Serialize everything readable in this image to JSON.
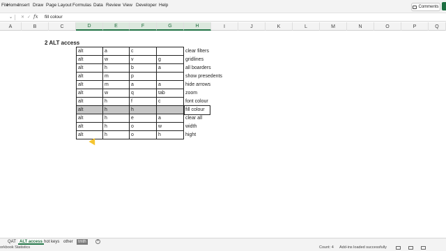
{
  "menu": {
    "items": [
      "File",
      "Home",
      "Insert",
      "Draw",
      "Page Layout",
      "Formulas",
      "Data",
      "Review",
      "View",
      "Developer",
      "Help"
    ],
    "comments_label": "Comments"
  },
  "formula_bar": {
    "fx": "fx",
    "content": "fill colour"
  },
  "columns": [
    "A",
    "B",
    "C",
    "D",
    "E",
    "F",
    "G",
    "H",
    "I",
    "J",
    "K",
    "L",
    "M",
    "N",
    "O",
    "P",
    "Q"
  ],
  "sheet": {
    "title": "2  ALT access",
    "rows": [
      {
        "c1": "alt",
        "c2": "a",
        "c3": "c",
        "c4": "",
        "desc": "clear filters"
      },
      {
        "c1": "alt",
        "c2": "w",
        "c3": "v",
        "c4": "g",
        "desc": "gridlines"
      },
      {
        "c1": "alt",
        "c2": "h",
        "c3": "b",
        "c4": "a",
        "desc": "all boarders"
      },
      {
        "c1": "alt",
        "c2": "m",
        "c3": "p",
        "c4": "",
        "desc": "show presedents"
      },
      {
        "c1": "alt",
        "c2": "m",
        "c3": "a",
        "c4": "a",
        "desc": "hide arrows"
      },
      {
        "c1": "alt",
        "c2": "w",
        "c3": "q",
        "c4": "tab",
        "desc": "zoom"
      },
      {
        "c1": "alt",
        "c2": "h",
        "c3": "f",
        "c4": "c",
        "desc": "font colour"
      },
      {
        "c1": "alt",
        "c2": "h",
        "c3": "h",
        "c4": "",
        "desc": "fill colour"
      },
      {
        "c1": "alt",
        "c2": "h",
        "c3": "e",
        "c4": "a",
        "desc": "clear all"
      },
      {
        "c1": "alt",
        "c2": "h",
        "c3": "o",
        "c4": "w",
        "desc": "width"
      },
      {
        "c1": "alt",
        "c2": "h",
        "c3": "o",
        "c4": "h",
        "desc": "hight"
      }
    ]
  },
  "tabs": [
    "QAT",
    "ALT access",
    "hot keys",
    "other",
    "tmth"
  ],
  "active_tab": "ALT access",
  "status": {
    "left": "orkbook Statistics",
    "count": "Count: 4",
    "addins": "Add-ins loaded successfully"
  },
  "colors": {
    "excel_green": "#217346",
    "highlight_fill": "#c6c6c6"
  }
}
